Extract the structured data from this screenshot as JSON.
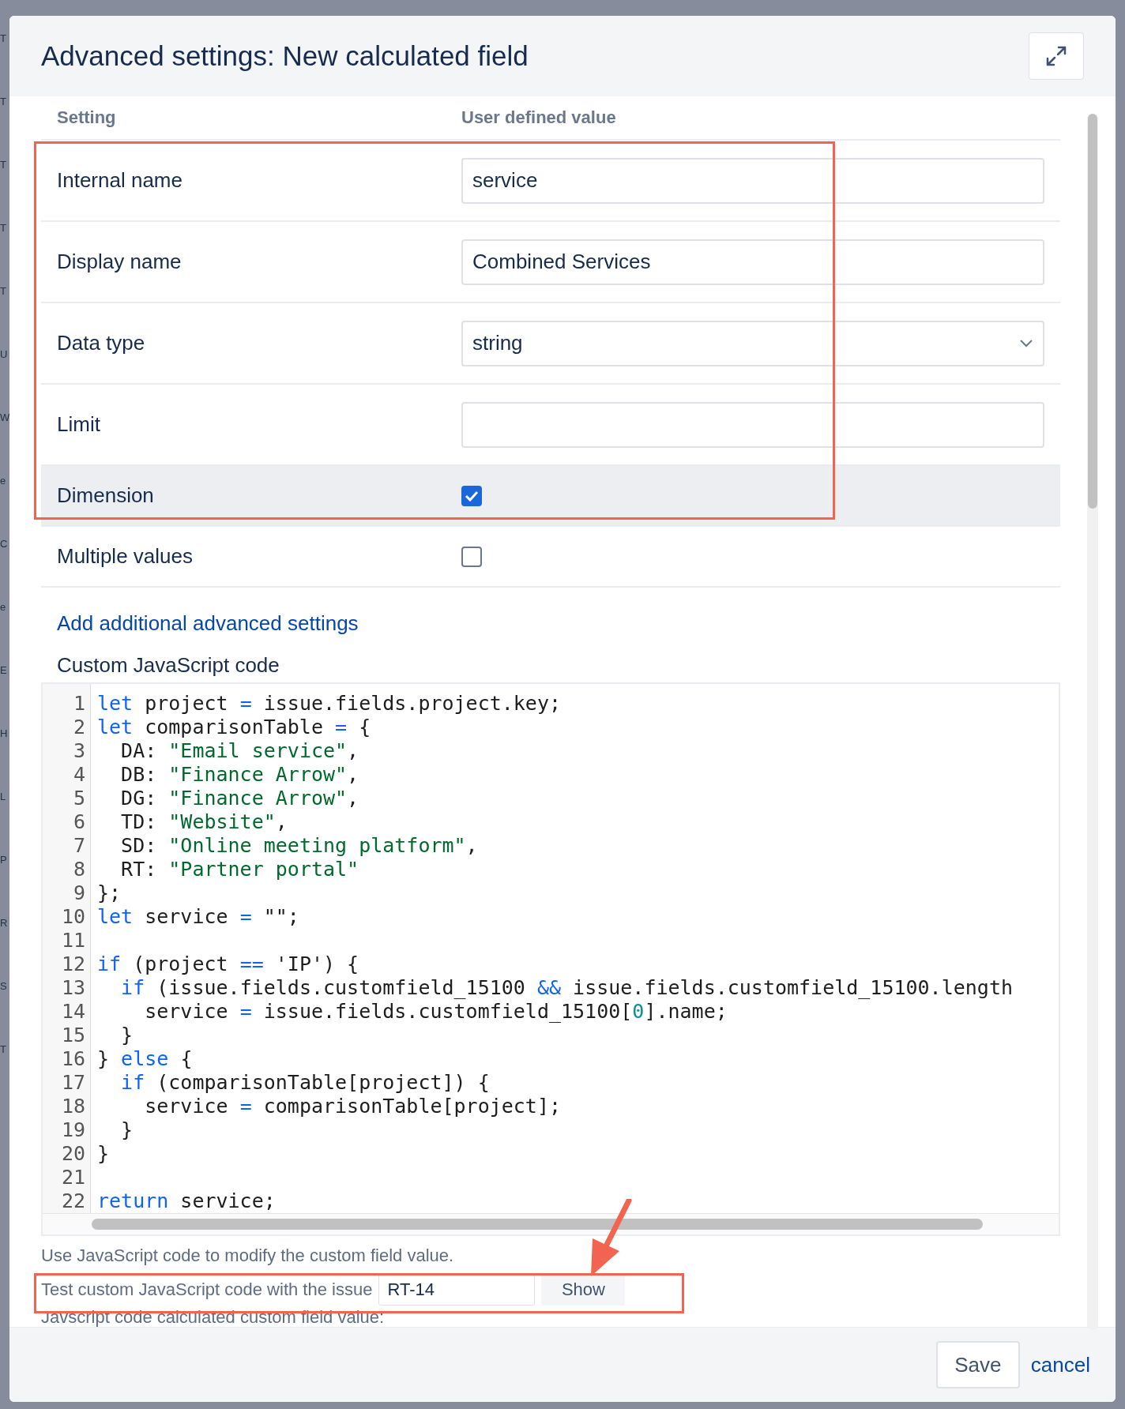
{
  "background_letters": [
    "T",
    "T",
    "T",
    "T",
    "T",
    "U",
    "W",
    "e",
    "C",
    "e",
    "E",
    "H",
    "L",
    "P",
    "R",
    "S",
    "T"
  ],
  "dialog": {
    "title": "Advanced settings: New calculated field"
  },
  "table": {
    "columns": [
      "Setting",
      "User defined value"
    ],
    "rows": [
      {
        "kind": "text",
        "label": "Internal name",
        "value": "service",
        "highlighted": false
      },
      {
        "kind": "text",
        "label": "Display name",
        "value": "Combined Services",
        "highlighted": false
      },
      {
        "kind": "select",
        "label": "Data type",
        "value": "string",
        "highlighted": false
      },
      {
        "kind": "text",
        "label": "Limit",
        "value": "",
        "highlighted": false
      },
      {
        "kind": "checkbox",
        "label": "Dimension",
        "checked": true,
        "highlighted": true
      },
      {
        "kind": "checkbox",
        "label": "Multiple values",
        "checked": false,
        "highlighted": false
      }
    ]
  },
  "add_link": "Add additional advanced settings",
  "code_label": "Custom JavaScript code",
  "code_lines": [
    {
      "number": "1",
      "tokens": [
        {
          "kind": "keyword",
          "text": "let"
        },
        {
          "kind": "plain",
          "text": " project "
        },
        {
          "kind": "keyword",
          "text": "="
        },
        {
          "kind": "plain",
          "text": " issue.fields.project.key;"
        }
      ]
    },
    {
      "number": "2",
      "tokens": [
        {
          "kind": "keyword",
          "text": "let"
        },
        {
          "kind": "plain",
          "text": " comparisonTable "
        },
        {
          "kind": "keyword",
          "text": "="
        },
        {
          "kind": "plain",
          "text": " {"
        }
      ]
    },
    {
      "number": "3",
      "tokens": [
        {
          "kind": "plain",
          "text": "  DA: "
        },
        {
          "kind": "string",
          "text": "\"Email service\""
        },
        {
          "kind": "plain",
          "text": ","
        }
      ]
    },
    {
      "number": "4",
      "tokens": [
        {
          "kind": "plain",
          "text": "  DB: "
        },
        {
          "kind": "string",
          "text": "\"Finance Arrow\""
        },
        {
          "kind": "plain",
          "text": ","
        }
      ]
    },
    {
      "number": "5",
      "tokens": [
        {
          "kind": "plain",
          "text": "  DG: "
        },
        {
          "kind": "string",
          "text": "\"Finance Arrow\""
        },
        {
          "kind": "plain",
          "text": ","
        }
      ]
    },
    {
      "number": "6",
      "tokens": [
        {
          "kind": "plain",
          "text": "  TD: "
        },
        {
          "kind": "string",
          "text": "\"Website\""
        },
        {
          "kind": "plain",
          "text": ","
        }
      ]
    },
    {
      "number": "7",
      "tokens": [
        {
          "kind": "plain",
          "text": "  SD: "
        },
        {
          "kind": "string",
          "text": "\"Online meeting platform\""
        },
        {
          "kind": "plain",
          "text": ","
        }
      ]
    },
    {
      "number": "8",
      "tokens": [
        {
          "kind": "plain",
          "text": "  RT: "
        },
        {
          "kind": "string",
          "text": "\"Partner portal\""
        }
      ]
    },
    {
      "number": "9",
      "tokens": [
        {
          "kind": "plain",
          "text": "};"
        }
      ]
    },
    {
      "number": "10",
      "tokens": [
        {
          "kind": "keyword",
          "text": "let"
        },
        {
          "kind": "plain",
          "text": " service "
        },
        {
          "kind": "keyword",
          "text": "="
        },
        {
          "kind": "plain",
          "text": " \"\";"
        }
      ]
    },
    {
      "number": "11"
    },
    {
      "number": "12",
      "tokens": [
        {
          "kind": "keyword",
          "text": "if"
        },
        {
          "kind": "plain",
          "text": " (project "
        },
        {
          "kind": "keyword",
          "text": "=="
        },
        {
          "kind": "plain",
          "text": " 'IP') {"
        }
      ]
    },
    {
      "number": "13",
      "tokens": [
        {
          "kind": "keyword",
          "text": "  if"
        },
        {
          "kind": "plain",
          "text": " (issue.fields.customfield_15100 "
        },
        {
          "kind": "keyword",
          "text": "&&"
        },
        {
          "kind": "plain",
          "text": " issue.fields.customfield_15100.length"
        }
      ]
    },
    {
      "number": "14",
      "tokens": [
        {
          "kind": "plain",
          "text": "    service "
        },
        {
          "kind": "keyword",
          "text": "="
        },
        {
          "kind": "plain",
          "text": " issue.fields.customfield_15100["
        },
        {
          "kind": "number",
          "text": "0"
        },
        {
          "kind": "plain",
          "text": "].name;"
        }
      ]
    },
    {
      "number": "15",
      "tokens": [
        {
          "kind": "plain",
          "text": "  }"
        }
      ]
    },
    {
      "number": "16",
      "tokens": [
        {
          "kind": "plain",
          "text": "} "
        },
        {
          "kind": "keyword",
          "text": "else"
        },
        {
          "kind": "plain",
          "text": " {"
        }
      ]
    },
    {
      "number": "17",
      "tokens": [
        {
          "kind": "keyword",
          "text": "  if"
        },
        {
          "kind": "plain",
          "text": " (comparisonTable[project]) {"
        }
      ]
    },
    {
      "number": "18",
      "tokens": [
        {
          "kind": "plain",
          "text": "    service "
        },
        {
          "kind": "keyword",
          "text": "="
        },
        {
          "kind": "plain",
          "text": " comparisonTable[project];"
        }
      ]
    },
    {
      "number": "19",
      "tokens": [
        {
          "kind": "plain",
          "text": "  }"
        }
      ]
    },
    {
      "number": "20",
      "tokens": [
        {
          "kind": "plain",
          "text": "}"
        }
      ]
    },
    {
      "number": "21"
    },
    {
      "number": "22",
      "tokens": [
        {
          "kind": "keyword",
          "text": "return"
        },
        {
          "kind": "plain",
          "text": " service;"
        }
      ]
    }
  ],
  "help_text": "Use JavaScript code to modify the custom field value.",
  "test": {
    "label": "Test custom JavaScript code with the issue",
    "value": "RT-14",
    "button": "Show"
  },
  "result_label": "Javscript code calculated custom field value:",
  "footer": {
    "save": "Save",
    "cancel": "cancel"
  }
}
